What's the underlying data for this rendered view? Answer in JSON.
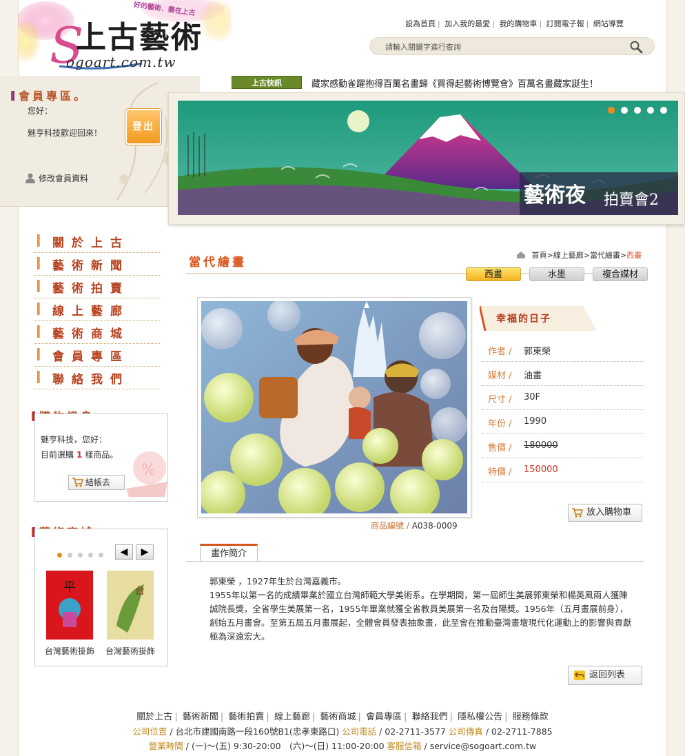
{
  "header": {
    "logo_tagline": "好的藝術．盡在上古",
    "logo_cn": "上古藝術",
    "logo_en": "ogoart.com.tw",
    "logo_s": "S",
    "top_links": [
      "設為首頁",
      "加入我的最愛",
      "我的購物車",
      "訂閱電子報",
      "網站導覽"
    ],
    "search_placeholder": "請輸入關鍵字進行查詢"
  },
  "news": {
    "tag": "上古快訊",
    "text": "藏家感動雀躍抱得百萬名畫歸《買得起藝術博覽會》百萬名畫藏家誕生！"
  },
  "member": {
    "title": "會員專區。",
    "hello": "您好：",
    "welcome": "魅亨科技歡迎回來！",
    "logout": "登出",
    "edit": "修改會員資料"
  },
  "banner": {
    "label_1": "藝術夜",
    "label_2": "拍賣會2",
    "slides": 5,
    "active_slide": 1
  },
  "leftnav": [
    "關於上古",
    "藝術新聞",
    "藝術拍賣",
    "線上藝廊",
    "藝術商城",
    "會員專區",
    "聯絡我們"
  ],
  "cart": {
    "title": "購物訊息。",
    "line1": "魅亨科技，您好：",
    "line2_prefix": "目前選購",
    "count": "1",
    "line2_suffix": "樣商品。",
    "checkout": "結帳去"
  },
  "mall": {
    "title": "藝術商城。",
    "prev": "◀",
    "next": "▶",
    "products": [
      {
        "name": "台灣藝術掛飾"
      },
      {
        "name": "台灣藝術掛飾"
      }
    ]
  },
  "content": {
    "category": "當代繪畫",
    "breadcrumb": [
      "首頁",
      "線上藝廊",
      "當代繪畫",
      "西畫"
    ],
    "tabs": [
      "西畫",
      "水墨",
      "複合媒材"
    ],
    "active_tab": 0,
    "art_no_label": "商品編號 /",
    "art_no": "A038-0009",
    "art_title": "幸福的日子",
    "specs": [
      {
        "k": "作者 /",
        "v": "郭東榮"
      },
      {
        "k": "媒材 /",
        "v": "油畫"
      },
      {
        "k": "尺寸 /",
        "v": "30F"
      },
      {
        "k": "年份 /",
        "v": "1990"
      },
      {
        "k": "售價 /",
        "v": "180000"
      },
      {
        "k": "特價 /",
        "v": "150000"
      }
    ],
    "add_to_cart": "放入購物車",
    "intro_tab": "畫作簡介",
    "intro_p1": "郭東榮 ，1927年生於台灣嘉義市。",
    "intro_p2": "1955年以第一名的成績畢業於國立台灣師範大學美術系。在學期間，第一屆師生美展郭東榮和楊英風兩人獲陳誠院長獎，全省學生美展第一名，1955年畢業就獲全省教員美展第一名及台陽獎。1956年（五月畫展前身），創始五月畫會。至第五屆五月畫展起，全體會員發表抽象畫，此至會在推動臺灣畫壇現代化運動上的影響與貢獻極為深遠宏大。",
    "back": "返回列表"
  },
  "footer": {
    "links": [
      "關於上古",
      "藝術新聞",
      "藝術拍賣",
      "線上藝廊",
      "藝術商城",
      "會員專區",
      "聯絡我們",
      "隱私權公告",
      "服務條款"
    ],
    "addr_k": "公司位置",
    "addr_v": " / 台北市建國南路一段160號B1(忠孝東路口) ",
    "tel_k": "公司電話",
    "tel_v": " / 02-2711-3577 ",
    "fax_k": "公司傳真",
    "fax_v": " / 02-2711-7885",
    "hours_k": "營業時間",
    "hours_v": " / (一)～(五) 9:30-20:00　(六)～(日) 11:00-20:00 ",
    "mail_k": "客服信箱",
    "mail_v": " / service@sogoart.com.tw"
  }
}
